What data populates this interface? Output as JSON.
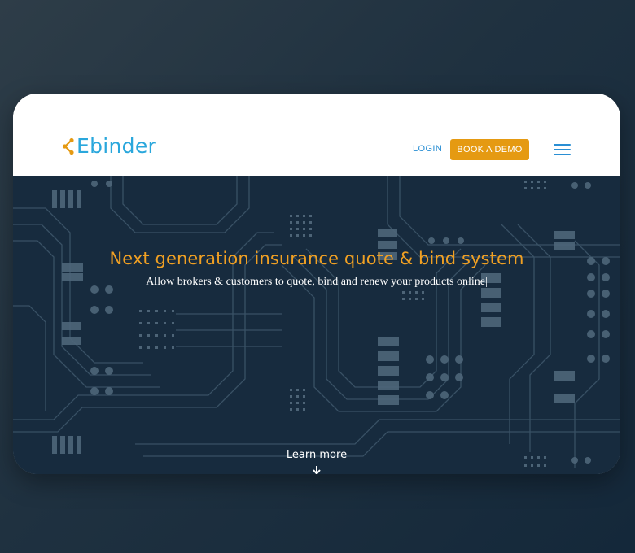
{
  "brand": {
    "name": "Ebinder"
  },
  "nav": {
    "login_label": "LOGIN",
    "demo_label": "BOOK A DEMO"
  },
  "hero": {
    "title": "Next generation insurance quote & bind system",
    "subtitle": "Allow brokers & customers to quote, bind and renew your products online|",
    "learn_more_label": "Learn more"
  },
  "colors": {
    "accent_orange": "#e59a12",
    "brand_blue": "#2aa7dc",
    "hero_background": "#172b3e"
  },
  "icons": [
    "logo-mark-icon",
    "hamburger-menu-icon",
    "arrow-down-icon"
  ]
}
